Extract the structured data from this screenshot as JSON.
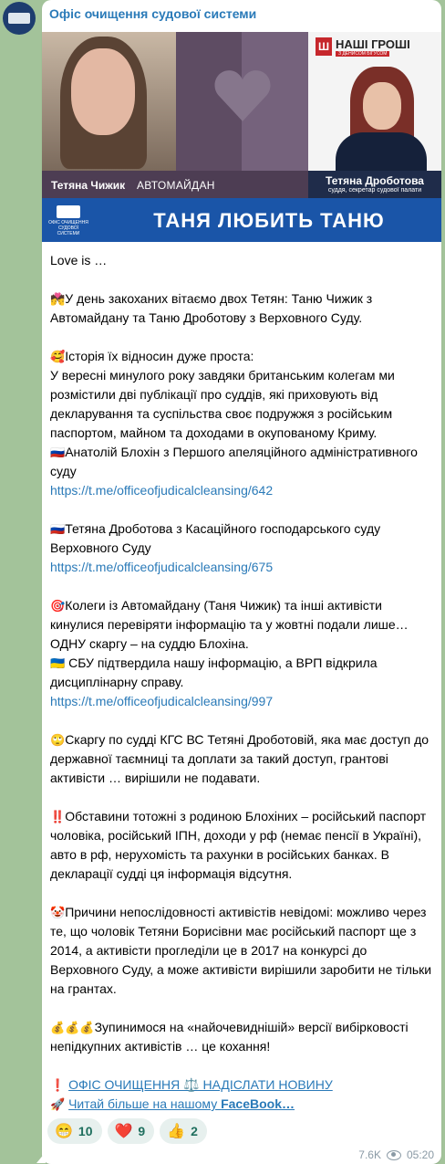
{
  "channel": {
    "name": "Офіс очищення судової системи"
  },
  "media": {
    "left_name": "Тетяна Чижик",
    "left_org": "АВТОМАЙДАН",
    "logo_mark": "Ш",
    "logo_text": "НАШІ ГРОШІ",
    "logo_sub": "З ДЕНИСОМ БІГУСОМ",
    "right_name": "Тетяна Дроботова",
    "right_role": "суддя, секретар судової палати",
    "banner_logo": "ОФІС ОЧИЩЕННЯ СУДОВОЇ СИСТЕМИ",
    "banner_title": "ТАНЯ ЛЮБИТЬ ТАНЮ"
  },
  "post": {
    "p1": "Love is …",
    "p2_emoji": "💏",
    "p2": "У день закоханих вітаємо двох Тетян: Таню Чижик з Автомайдану та Таню Дроботову з Верховного Суду.",
    "p3_emoji": "🥰",
    "p3a": "Історія їх відносин дуже проста:",
    "p3b": "У вересні минулого року завдяки британським колегам ми розмістили дві публікації про суддів, які приховують від декларування та суспільства своє подружжя з російським паспортом, майном та доходами в окупованому Криму.",
    "p3c_emoji": "🇷🇺",
    "p3c": "Анатолій Блохін з Першого апеляційного адміністративного суду",
    "link1": "https://t.me/officeofjudicalcleansing/642",
    "p4_emoji": "🇷🇺",
    "p4": "Тетяна Дроботова з Касаційного господарського суду Верховного Суду",
    "link2": "https://t.me/officeofjudicalcleansing/675",
    "p5_emoji": "🎯",
    "p5": "Колеги із Автомайдану (Таня Чижик) та інші активісти кинулися перевіряти інформацію та у жовтні подали лише… ОДНУ скаргу – на суддю Блохіна.",
    "p5b_emoji": "🇺🇦",
    "p5b": " СБУ підтвердила нашу інформацію, а ВРП відкрила дисциплінарну справу.",
    "link3": "https://t.me/officeofjudicalcleansing/997",
    "p6_emoji": "🙄",
    "p6": "Скаргу по судді КГС ВС Тетяні Дроботовій, яка має доступ до державної таємниці та доплати за такий доступ, грантові активісти … вирішили не подавати.",
    "p7_emoji": "‼️",
    "p7": "Обставини тотожні з родиною Блохіних – російський паспорт чоловіка, російський ІПН, доходи у рф (немає пенсії в Україні), авто в рф, нерухомість та рахунки в російських банках. В декларації судді ця інформація відсутня.",
    "p8_emoji": "🤡",
    "p8": "Причини непослідовності активістів невідомі: можливо через те, що чоловік Тетяни Борисівни має російський паспорт ще з 2014, а активісти прогледіли це в 2017 на конкурсі до Верховного Суду, а може активісти вирішили заробити не тільки на грантах.",
    "p9_emoji": "💰💰💰",
    "p9": "Зупинимося на «найочевиднішій» версії вибірковості непідкупних активістів … це кохання!",
    "cta1_emoji": "❗",
    "cta1": "ОФІС ОЧИЩЕННЯ ⚖️ НАДІСЛАТИ НОВИНУ",
    "cta2_emoji": "🚀",
    "cta2_pre": "Читай більше на нашому ",
    "cta2_strong": "FaceBook…"
  },
  "reactions": [
    {
      "emoji": "😁",
      "count": "10"
    },
    {
      "emoji": "❤️",
      "count": "9"
    },
    {
      "emoji": "👍",
      "count": "2"
    }
  ],
  "meta": {
    "views": "7.6K",
    "time": "05:20"
  },
  "colors": {
    "link": "#2a7ab8",
    "banner": "#1a55a8",
    "chat_bg": "#a3c39a"
  }
}
